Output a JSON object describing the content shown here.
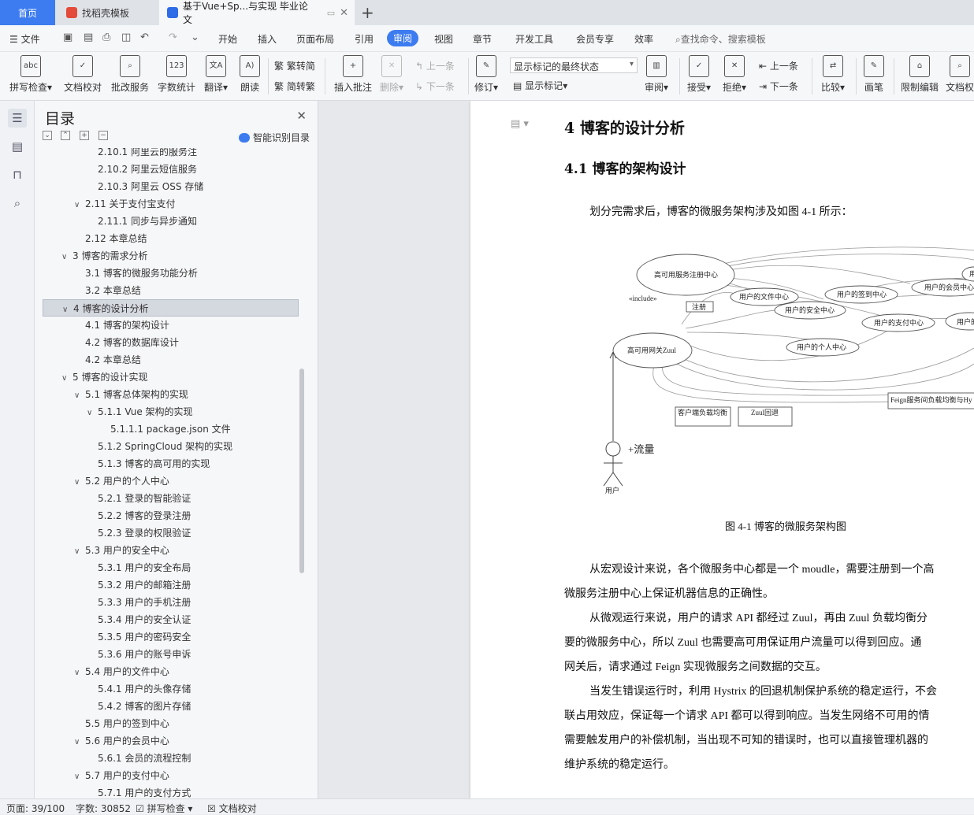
{
  "tabs": {
    "home": "首页",
    "doc1": "找稻壳模板",
    "doc2": "基于Vue+Sp...与实现 毕业论文"
  },
  "menu": {
    "file": "文件",
    "items": [
      "开始",
      "插入",
      "页面布局",
      "引用",
      "审阅",
      "视图",
      "章节",
      "开发工具",
      "会员专享",
      "效率"
    ],
    "active": "审阅",
    "search_placeholder": "查找命令、搜索模板"
  },
  "ribbon": {
    "spell": "拼写检查",
    "doc_check": "文档校对",
    "batch": "批改服务",
    "word_count": "字数统计",
    "translate": "翻译",
    "read": "朗读",
    "to_trad": "繁转简",
    "to_simp": "简转繁",
    "insert_comment": "插入批注",
    "delete": "删除",
    "prev": "上一条",
    "next": "下一条",
    "revise": "修订",
    "mark_state": "显示标记的最终状态",
    "show_marks": "显示标记",
    "review": "审阅",
    "accept": "接受",
    "reject": "拒绝",
    "prev2": "上一条",
    "next2": "下一条",
    "compare": "比较",
    "pen": "画笔",
    "restrict": "限制编辑",
    "doc_perm": "文档权"
  },
  "toc": {
    "title": "目录",
    "smart": "智能识别目录",
    "items": [
      {
        "text": "2.10.1 阿里云的服务注",
        "level": 3,
        "chev": ""
      },
      {
        "text": "2.10.2  阿里云短信服务",
        "level": 3,
        "chev": ""
      },
      {
        "text": "2.10.3  阿里云 OSS 存储",
        "level": 3,
        "chev": ""
      },
      {
        "text": "2.11  关于支付宝支付",
        "level": 2,
        "chev": "v"
      },
      {
        "text": "2.11.1  同步与异步通知",
        "level": 3,
        "chev": ""
      },
      {
        "text": "2.12  本章总结",
        "level": 2,
        "chev": ""
      },
      {
        "text": "3  博客的需求分析",
        "level": 1,
        "chev": "v"
      },
      {
        "text": "3.1  博客的微服务功能分析",
        "level": 2,
        "chev": ""
      },
      {
        "text": "3.2  本章总结",
        "level": 2,
        "chev": ""
      },
      {
        "text": "4  博客的设计分析",
        "level": 1,
        "chev": "v",
        "selected": true
      },
      {
        "text": "4.1  博客的架构设计",
        "level": 2,
        "chev": ""
      },
      {
        "text": "4.2  博客的数据库设计",
        "level": 2,
        "chev": ""
      },
      {
        "text": "4.2  本章总结",
        "level": 2,
        "chev": ""
      },
      {
        "text": "5  博客的设计实现",
        "level": 1,
        "chev": "v"
      },
      {
        "text": "5.1  博客总体架构的实现",
        "level": 2,
        "chev": "v"
      },
      {
        "text": "5.1.1 Vue 架构的实现",
        "level": 3,
        "chev": "v"
      },
      {
        "text": "5.1.1.1 package.json 文件",
        "level": 4,
        "chev": ""
      },
      {
        "text": "5.1.2 SpringCloud 架构的实现",
        "level": 3,
        "chev": ""
      },
      {
        "text": "5.1.3  博客的高可用的实现",
        "level": 3,
        "chev": ""
      },
      {
        "text": "5.2  用户的个人中心",
        "level": 2,
        "chev": "v"
      },
      {
        "text": "5.2.1  登录的智能验证",
        "level": 3,
        "chev": ""
      },
      {
        "text": "5.2.2  博客的登录注册",
        "level": 3,
        "chev": ""
      },
      {
        "text": "5.2.3  登录的权限验证",
        "level": 3,
        "chev": ""
      },
      {
        "text": "5.3  用户的安全中心",
        "level": 2,
        "chev": "v"
      },
      {
        "text": "5.3.1  用户的安全布局",
        "level": 3,
        "chev": ""
      },
      {
        "text": "5.3.2  用户的邮箱注册",
        "level": 3,
        "chev": ""
      },
      {
        "text": "5.3.3  用户的手机注册",
        "level": 3,
        "chev": ""
      },
      {
        "text": "5.3.4  用户的安全认证",
        "level": 3,
        "chev": ""
      },
      {
        "text": "5.3.5  用户的密码安全",
        "level": 3,
        "chev": ""
      },
      {
        "text": "5.3.6  用户的账号申诉",
        "level": 3,
        "chev": ""
      },
      {
        "text": "5.4  用户的文件中心",
        "level": 2,
        "chev": "v"
      },
      {
        "text": "5.4.1  用户的头像存储",
        "level": 3,
        "chev": ""
      },
      {
        "text": "5.4.2  博客的图片存储",
        "level": 3,
        "chev": ""
      },
      {
        "text": "5.5  用户的签到中心",
        "level": 2,
        "chev": ""
      },
      {
        "text": "5.6  用户的会员中心",
        "level": 2,
        "chev": "v"
      },
      {
        "text": "5.6.1  会员的流程控制",
        "level": 3,
        "chev": ""
      },
      {
        "text": "5.7  用户的支付中心",
        "level": 2,
        "chev": "v"
      },
      {
        "text": "5.7.1  用户的支付方式",
        "level": 3,
        "chev": ""
      }
    ]
  },
  "document": {
    "h1": "4  博客的设计分析",
    "h2": "4.1  博客的架构设计",
    "intro": "划分完需求后，博客的微服务架构涉及如图 4-1 所示：",
    "caption": "图 4-1  博客的微服务架构图",
    "diagram": {
      "registry": "高可用服务注册中心",
      "include": "«include»",
      "register": "注册",
      "file_center": "用户的文件中心",
      "security_center": "用户的安全中心",
      "signin_center": "用户的签到中心",
      "member_center": "用户的会员中心",
      "pay_center": "用户的支付中心",
      "personal_center": "用户的个人中心",
      "gateway": "高可用网关Zuul",
      "lb": "客户端负载均衡",
      "fallback": "Zuul回退",
      "feign": "Feign服务间负载均衡与Hy",
      "traffic": "+流量",
      "user": "用户",
      "cut1": "用户的",
      "cut2": "用"
    },
    "lines": [
      "从宏观设计来说，各个微服务中心都是一个 moudle，需要注册到一个高",
      "微服务注册中心上保证机器信息的正确性。",
      "从微观运行来说，用户的请求 API 都经过 Zuul，再由 Zuul 负载均衡分",
      "要的微服务中心，所以 Zuul 也需要高可用保证用户流量可以得到回应。通",
      "网关后，请求通过 Feign 实现微服务之间数据的交互。",
      "当发生错误运行时，利用 Hystrix 的回退机制保护系统的稳定运行，不会",
      "联占用效应，保证每一个请求 API 都可以得到响应。当发生网络不可用的情",
      "需要触发用户的补偿机制，当出现不可知的错误时，也可以直接管理机器的",
      "维护系统的稳定运行。"
    ]
  },
  "status": {
    "page": "页面: 39/100",
    "words": "字数: 30852",
    "spell": "拼写检查",
    "doccheck": "文档校对"
  }
}
